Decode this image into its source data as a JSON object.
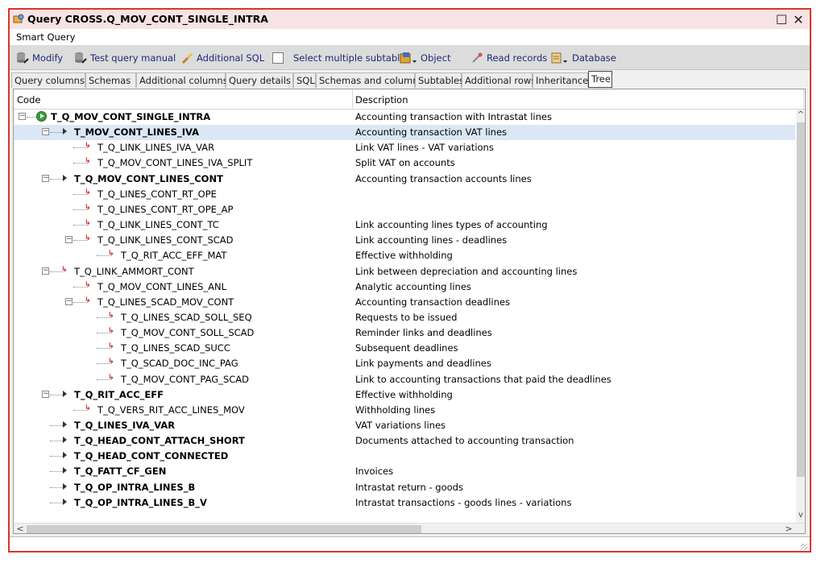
{
  "window": {
    "title": "Query CROSS.Q_MOV_CONT_SINGLE_INTRA",
    "maximize_icon": "☐",
    "close_icon": "✕"
  },
  "menu": {
    "label": "Smart Query"
  },
  "toolbar": {
    "modify": "Modify",
    "test_query_manual": "Test query manual",
    "additional_sql": "Additional SQL",
    "select_multiple_subtables": "Select multiple subtables",
    "object": "Object",
    "read_records": "Read records",
    "database": "Database"
  },
  "tabs": [
    "Query columns",
    "Schemas",
    "Additional columns",
    "Query details",
    "SQL",
    "Schemas and columns",
    "Subtables",
    "Additional rows",
    "Inheritance",
    "Tree"
  ],
  "active_tab": "Tree",
  "tree": {
    "columns": {
      "code": "Code",
      "description": "Description"
    },
    "rows": [
      {
        "code": "T_Q_MOV_CONT_SINGLE_INTRA",
        "desc": "Accounting transaction with Intrastat lines",
        "level": 0,
        "bold": true,
        "icon": "root",
        "expander": "minus"
      },
      {
        "code": "T_MOV_CONT_LINES_IVA",
        "desc": "Accounting transaction VAT lines",
        "level": 1,
        "bold": true,
        "icon": "arrow",
        "expander": "minus",
        "selected": true
      },
      {
        "code": "T_Q_LINK_LINES_IVA_VAR",
        "desc": "Link VAT lines - VAT variations",
        "level": 2,
        "bold": false,
        "icon": "link"
      },
      {
        "code": "T_Q_MOV_CONT_LINES_IVA_SPLIT",
        "desc": "Split VAT on accounts",
        "level": 2,
        "bold": false,
        "icon": "link"
      },
      {
        "code": "T_Q_MOV_CONT_LINES_CONT",
        "desc": "Accounting transaction accounts lines",
        "level": 1,
        "bold": true,
        "icon": "arrow",
        "expander": "minus"
      },
      {
        "code": "T_Q_LINES_CONT_RT_OPE",
        "desc": "",
        "level": 2,
        "bold": false,
        "icon": "link"
      },
      {
        "code": "T_Q_LINES_CONT_RT_OPE_AP",
        "desc": "",
        "level": 2,
        "bold": false,
        "icon": "link"
      },
      {
        "code": "T_Q_LINK_LINES_CONT_TC",
        "desc": "Link accounting lines types of accounting",
        "level": 2,
        "bold": false,
        "icon": "link"
      },
      {
        "code": "T_Q_LINK_LINES_CONT_SCAD",
        "desc": "Link accounting lines - deadlines",
        "level": 2,
        "bold": false,
        "icon": "link",
        "expander": "minus"
      },
      {
        "code": "T_Q_RIT_ACC_EFF_MAT",
        "desc": "Effective withholding",
        "level": 3,
        "bold": false,
        "icon": "link"
      },
      {
        "code": "T_Q_LINK_AMMORT_CONT",
        "desc": "Link between depreciation and accounting lines",
        "level": 1,
        "bold": false,
        "icon": "link",
        "expander": "minus"
      },
      {
        "code": "T_Q_MOV_CONT_LINES_ANL",
        "desc": "Analytic accounting lines",
        "level": 2,
        "bold": false,
        "icon": "link"
      },
      {
        "code": "T_Q_LINES_SCAD_MOV_CONT",
        "desc": "Accounting transaction deadlines",
        "level": 2,
        "bold": false,
        "icon": "link",
        "expander": "minus"
      },
      {
        "code": "T_Q_LINES_SCAD_SOLL_SEQ",
        "desc": "Requests to be issued",
        "level": 3,
        "bold": false,
        "icon": "link"
      },
      {
        "code": "T_Q_MOV_CONT_SOLL_SCAD",
        "desc": "Reminder links and deadlines",
        "level": 3,
        "bold": false,
        "icon": "link"
      },
      {
        "code": "T_Q_LINES_SCAD_SUCC",
        "desc": "Subsequent deadlines",
        "level": 3,
        "bold": false,
        "icon": "link"
      },
      {
        "code": "T_Q_SCAD_DOC_INC_PAG",
        "desc": "Link payments and deadlines",
        "level": 3,
        "bold": false,
        "icon": "link"
      },
      {
        "code": "T_Q_MOV_CONT_PAG_SCAD",
        "desc": "Link to accounting transactions that paid the deadlines",
        "level": 3,
        "bold": false,
        "icon": "link"
      },
      {
        "code": "T_Q_RIT_ACC_EFF",
        "desc": "Effective withholding",
        "level": 1,
        "bold": true,
        "icon": "arrow",
        "expander": "minus"
      },
      {
        "code": "T_Q_VERS_RIT_ACC_LINES_MOV",
        "desc": "Withholding lines",
        "level": 2,
        "bold": false,
        "icon": "link"
      },
      {
        "code": "T_Q_LINES_IVA_VAR",
        "desc": "VAT variations lines",
        "level": 1,
        "bold": true,
        "icon": "arrow"
      },
      {
        "code": "T_Q_HEAD_CONT_ATTACH_SHORT",
        "desc": "Documents attached to accounting transaction",
        "level": 1,
        "bold": true,
        "icon": "arrow"
      },
      {
        "code": "T_Q_HEAD_CONT_CONNECTED",
        "desc": "",
        "level": 1,
        "bold": true,
        "icon": "arrow"
      },
      {
        "code": "T_Q_FATT_CF_GEN",
        "desc": "Invoices",
        "level": 1,
        "bold": true,
        "icon": "arrow"
      },
      {
        "code": "T_Q_OP_INTRA_LINES_B",
        "desc": "Intrastat return - goods",
        "level": 1,
        "bold": true,
        "icon": "arrow"
      },
      {
        "code": "T_Q_OP_INTRA_LINES_B_V",
        "desc": "Intrastat transactions - goods lines - variations",
        "level": 1,
        "bold": true,
        "icon": "arrow"
      }
    ]
  }
}
